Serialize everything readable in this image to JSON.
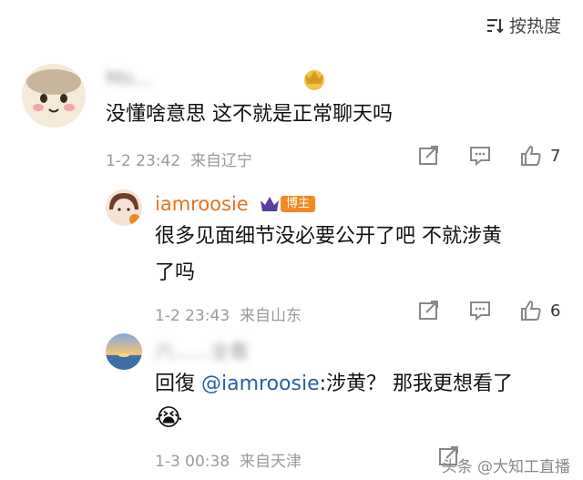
{
  "sort": {
    "label": "按热度",
    "icon": "sort-lines-icon"
  },
  "comments": [
    {
      "username": "Mo...",
      "username_hidden": true,
      "badge_icon": "crown-gold-icon",
      "text": "没懂啥意思 这不就是正常聊天吗",
      "time": "1-2 23:42",
      "location": "来自辽宁",
      "likes": "7",
      "avatar_icon": "cartoon-face-avatar"
    },
    {
      "username": "iamroosie",
      "username_hidden": false,
      "badge_icon": "crown-purple-icon",
      "role_badge": "博主",
      "text_line1": "很多见面细节没必要公开了吧 不就涉黄",
      "text_line2": "了吗",
      "time": "1-2 23:43",
      "location": "来自山东",
      "likes": "6",
      "avatar_icon": "girl-avatar"
    },
    {
      "username": "六......全看",
      "username_hidden": true,
      "reply_prefix": "回復",
      "mention": "@iamroosie",
      "text": ":涉黄？ 那我更想看了",
      "emoji": "😭",
      "time": "1-3 00:38",
      "location": "来自天津",
      "avatar_icon": "sunset-sea-avatar"
    }
  ],
  "watermark": "头条 @大知工直播",
  "colors": {
    "author_name": "#e8701f",
    "mention": "#2b5ea8",
    "meta": "#9a9a9a",
    "host_badge": "#f08a24"
  }
}
